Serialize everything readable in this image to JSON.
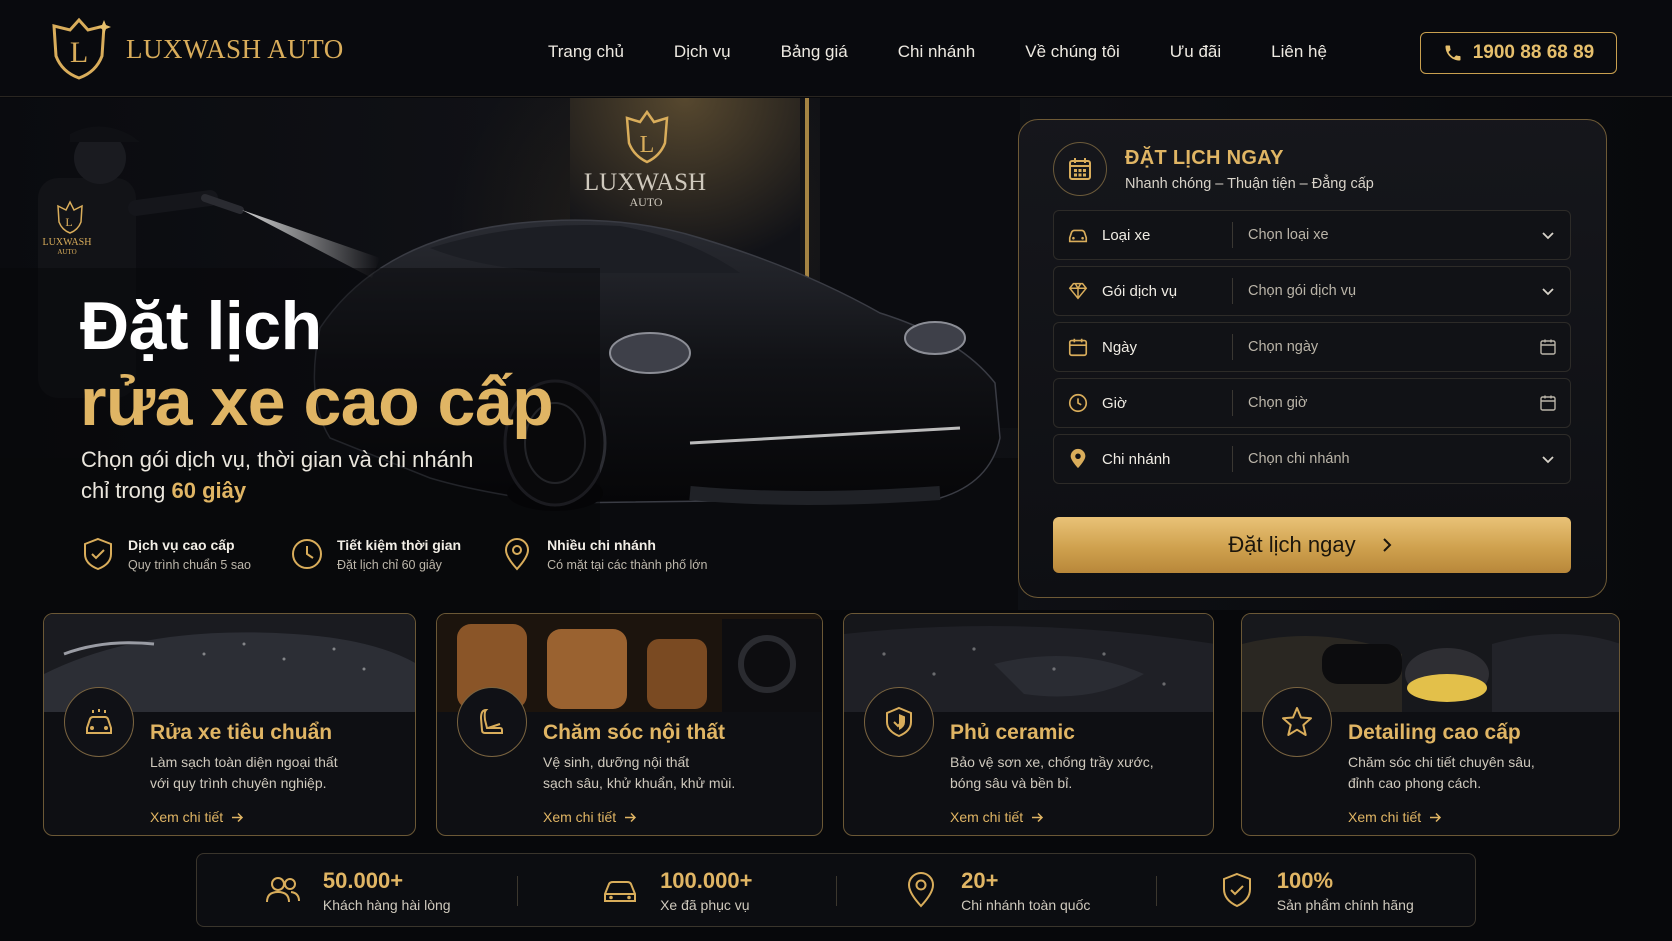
{
  "brand": {
    "name": "LUXWASH AUTO"
  },
  "nav": {
    "items": [
      {
        "label": "Trang chủ"
      },
      {
        "label": "Dịch vụ"
      },
      {
        "label": "Bảng giá"
      },
      {
        "label": "Chi nhánh"
      },
      {
        "label": "Về chúng tôi"
      },
      {
        "label": "Ưu đãi"
      },
      {
        "label": "Liên hệ"
      }
    ],
    "phone": "1900 88 68 89"
  },
  "hero": {
    "title_line1": "Đặt lịch",
    "title_line2": "rửa xe cao cấp",
    "subtitle_line1": "Chọn gói dịch vụ, thời gian và chi nhánh",
    "subtitle_prefix": "chỉ trong ",
    "subtitle_highlight": "60 giây",
    "sign_brand": "LUXWASH",
    "sign_sub": "AUTO",
    "shirt_brand": "LUXWASH",
    "shirt_sub": "AUTO",
    "features": [
      {
        "title": "Dịch vụ cao cấp",
        "desc": "Quy trình chuẩn 5 sao",
        "icon": "shield-check-icon"
      },
      {
        "title": "Tiết kiệm thời gian",
        "desc": "Đặt lịch chỉ 60 giây",
        "icon": "clock-icon"
      },
      {
        "title": "Nhiều chi nhánh",
        "desc": "Có mặt tại các thành phố lớn",
        "icon": "map-pin-icon"
      }
    ]
  },
  "booking": {
    "title": "ĐẶT LỊCH NGAY",
    "subtitle": "Nhanh chóng – Thuận tiện – Đẳng cấp",
    "fields": [
      {
        "label": "Loại xe",
        "placeholder": "Chọn loại xe",
        "icon": "car-icon",
        "control": "chevron-down-icon"
      },
      {
        "label": "Gói dịch vụ",
        "placeholder": "Chọn gói dịch vụ",
        "icon": "diamond-icon",
        "control": "chevron-down-icon"
      },
      {
        "label": "Ngày",
        "placeholder": "Chọn ngày",
        "icon": "calendar-icon",
        "control": "calendar-icon"
      },
      {
        "label": "Giờ",
        "placeholder": "Chọn giờ",
        "icon": "clock-icon",
        "control": "calendar-icon"
      },
      {
        "label": "Chi nhánh",
        "placeholder": "Chọn chi nhánh",
        "icon": "map-pin-icon",
        "control": "chevron-down-icon"
      }
    ],
    "submit_label": "Đặt lịch ngay"
  },
  "services": [
    {
      "title": "Rửa xe tiêu chuẩn",
      "desc_line1": "Làm sạch toàn diện ngoại thất",
      "desc_line2": "với quy trình chuyên nghiệp.",
      "link": "Xem chi tiết",
      "icon": "car-wash-icon"
    },
    {
      "title": "Chăm sóc nội thất",
      "desc_line1": "Vệ sinh, dưỡng nội thất",
      "desc_line2": "sạch sâu, khử khuẩn, khử mùi.",
      "link": "Xem chi tiết",
      "icon": "car-seat-icon"
    },
    {
      "title": "Phủ ceramic",
      "desc_line1": "Bảo vệ sơn xe, chống trầy xước,",
      "desc_line2": "bóng sâu và bền bỉ.",
      "link": "Xem chi tiết",
      "icon": "shield-icon"
    },
    {
      "title": "Detailing cao cấp",
      "desc_line1": "Chăm sóc chi tiết chuyên sâu,",
      "desc_line2": "đỉnh cao phong cách.",
      "link": "Xem chi tiết",
      "icon": "star-icon"
    }
  ],
  "stats": [
    {
      "value": "50.000+",
      "label": "Khách hàng hài lòng",
      "icon": "users-icon"
    },
    {
      "value": "100.000+",
      "label": "Xe đã phục vụ",
      "icon": "car-icon"
    },
    {
      "value": "20+",
      "label": "Chi nhánh toàn quốc",
      "icon": "map-pin-icon"
    },
    {
      "value": "100%",
      "label": "Sản phẩm chính hãng",
      "icon": "shield-check-icon"
    }
  ],
  "colors": {
    "accent": "#d9ad5b",
    "background": "#07080b"
  }
}
